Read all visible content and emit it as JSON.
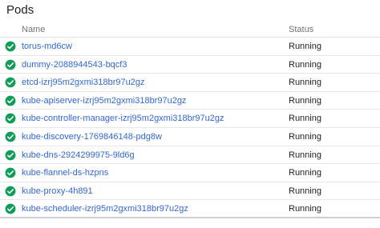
{
  "panel": {
    "title": "Pods"
  },
  "table": {
    "columns": {
      "name": "Name",
      "status": "Status"
    },
    "rows": [
      {
        "name": "torus-md6cw",
        "status": "Running"
      },
      {
        "name": "dummy-2088944543-bqcf3",
        "status": "Running"
      },
      {
        "name": "etcd-izrj95m2gxmi318br97u2gz",
        "status": "Running"
      },
      {
        "name": "kube-apiserver-izrj95m2gxmi318br97u2gz",
        "status": "Running"
      },
      {
        "name": "kube-controller-manager-izrj95m2gxmi318br97u2gz",
        "status": "Running"
      },
      {
        "name": "kube-discovery-1769846148-pdg8w",
        "status": "Running"
      },
      {
        "name": "kube-dns-2924299975-9ld6g",
        "status": "Running"
      },
      {
        "name": "kube-flannel-ds-hzpns",
        "status": "Running"
      },
      {
        "name": "kube-proxy-4h891",
        "status": "Running"
      },
      {
        "name": "kube-scheduler-izrj95m2gxmi318br97u2gz",
        "status": "Running"
      }
    ]
  },
  "colors": {
    "success": "#0f9d58",
    "link": "#3367d6"
  },
  "icons": {
    "status": "check-circle-icon"
  }
}
